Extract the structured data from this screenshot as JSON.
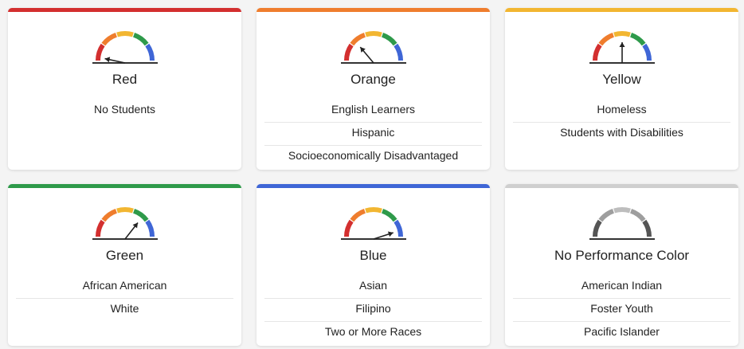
{
  "colors": {
    "red": "#d32f2f",
    "orange": "#ef7d2d",
    "yellow": "#f2b631",
    "green": "#2e9a4a",
    "blue": "#3f66d6",
    "gray": "#cfcfcf",
    "needle": "#222222"
  },
  "cards": [
    {
      "key": "red",
      "title": "Red",
      "bar_color": "#d32f2f",
      "gauge": "colored",
      "needle_angle": 168,
      "groups": [
        "No Students"
      ]
    },
    {
      "key": "orange",
      "title": "Orange",
      "bar_color": "#ef7d2d",
      "gauge": "colored",
      "needle_angle": 130,
      "groups": [
        "English Learners",
        "Hispanic",
        "Socioeconomically Disadvantaged"
      ]
    },
    {
      "key": "yellow",
      "title": "Yellow",
      "bar_color": "#f2b631",
      "gauge": "colored",
      "needle_angle": 90,
      "groups": [
        "Homeless",
        "Students with Disabilities"
      ]
    },
    {
      "key": "green",
      "title": "Green",
      "bar_color": "#2e9a4a",
      "gauge": "colored",
      "needle_angle": 52,
      "groups": [
        "African American",
        "White"
      ]
    },
    {
      "key": "blue",
      "title": "Blue",
      "bar_color": "#3f66d6",
      "gauge": "colored",
      "needle_angle": 18,
      "groups": [
        "Asian",
        "Filipino",
        "Two or More Races"
      ]
    },
    {
      "key": "none",
      "title": "No Performance Color",
      "bar_color": "#cfcfcf",
      "gauge": "gray",
      "needle_angle": null,
      "groups": [
        "American Indian",
        "Foster Youth",
        "Pacific Islander"
      ]
    }
  ]
}
